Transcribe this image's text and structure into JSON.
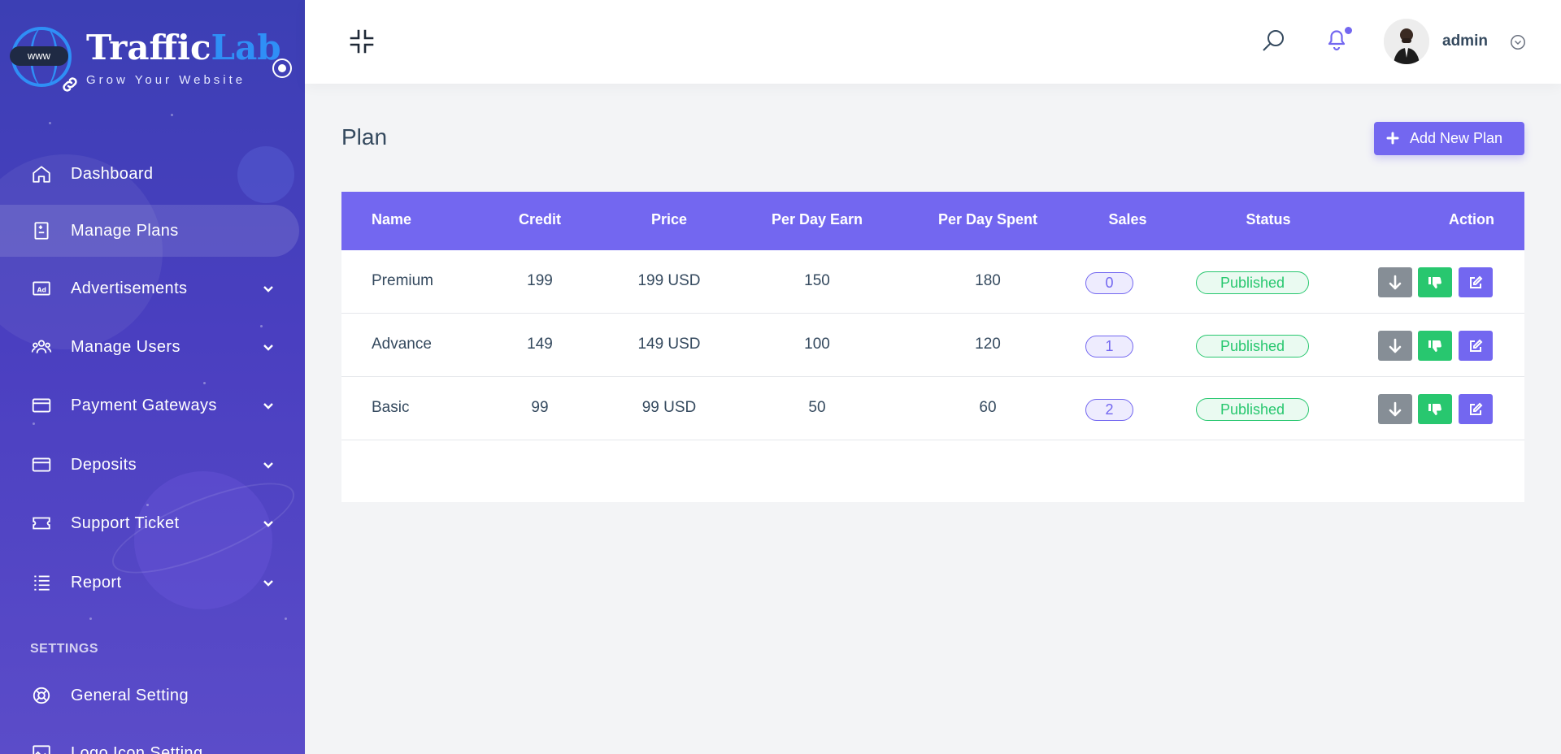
{
  "brand": {
    "name_part1": "Traffic",
    "name_part2": "Lab",
    "tagline": "Grow Your Website",
    "globe_text": "www"
  },
  "sidebar": {
    "items": [
      {
        "label": "Dashboard",
        "icon": "home-icon",
        "has_submenu": false,
        "active": false
      },
      {
        "label": "Manage Plans",
        "icon": "plan-icon",
        "has_submenu": false,
        "active": true
      },
      {
        "label": "Advertisements",
        "icon": "ad-icon",
        "has_submenu": true,
        "active": false
      },
      {
        "label": "Manage Users",
        "icon": "users-icon",
        "has_submenu": true,
        "active": false
      },
      {
        "label": "Payment Gateways",
        "icon": "credit-card-icon",
        "has_submenu": true,
        "active": false
      },
      {
        "label": "Deposits",
        "icon": "credit-card-icon",
        "has_submenu": true,
        "active": false
      },
      {
        "label": "Support Ticket",
        "icon": "ticket-icon",
        "has_submenu": true,
        "active": false
      },
      {
        "label": "Report",
        "icon": "list-icon",
        "has_submenu": true,
        "active": false
      }
    ],
    "settings_title": "SETTINGS",
    "settings_items": [
      {
        "label": "General Setting",
        "icon": "lifebuoy-icon"
      },
      {
        "label": "Logo Icon Setting",
        "icon": "image-icon"
      }
    ]
  },
  "topbar": {
    "username": "admin"
  },
  "page": {
    "title": "Plan",
    "add_button_label": "Add New Plan"
  },
  "table": {
    "columns": [
      "Name",
      "Credit",
      "Price",
      "Per Day Earn",
      "Per Day Spent",
      "Sales",
      "Status",
      "Action"
    ],
    "rows": [
      {
        "name": "Premium",
        "credit": "199",
        "price": "199 USD",
        "per_day_earn": "150",
        "per_day_spent": "180",
        "sales": "0",
        "status": "Published"
      },
      {
        "name": "Advance",
        "credit": "149",
        "price": "149 USD",
        "per_day_earn": "100",
        "per_day_spent": "120",
        "sales": "1",
        "status": "Published"
      },
      {
        "name": "Basic",
        "credit": "99",
        "price": "99 USD",
        "per_day_earn": "50",
        "per_day_spent": "60",
        "sales": "2",
        "status": "Published"
      }
    ]
  },
  "colors": {
    "primary": "#7367f0",
    "success": "#28c76f",
    "secondary": "#868e96",
    "sidebar_top": "#3c3fb4",
    "sidebar_bottom": "#5b4cc9",
    "brand_blue": "#2f8ff6"
  }
}
